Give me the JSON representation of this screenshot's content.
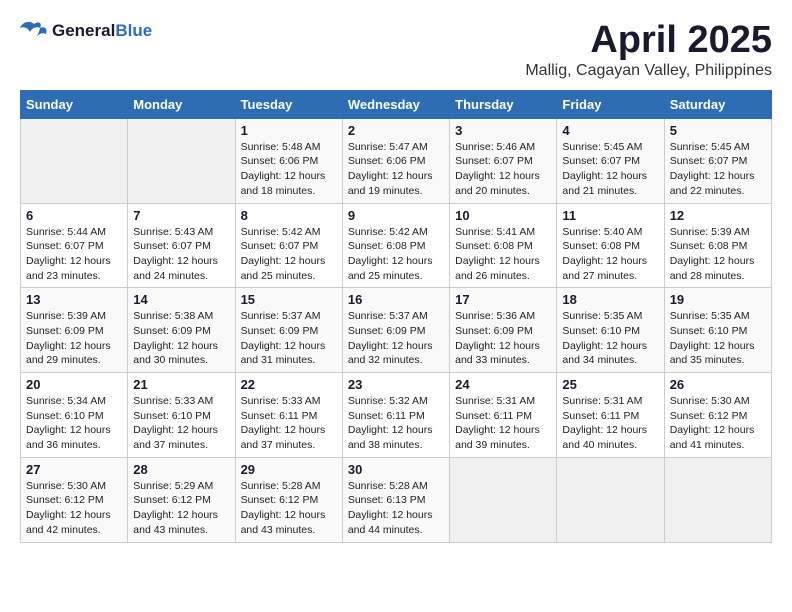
{
  "header": {
    "logo_line1": "General",
    "logo_line2": "Blue",
    "month_title": "April 2025",
    "location": "Mallig, Cagayan Valley, Philippines"
  },
  "weekdays": [
    "Sunday",
    "Monday",
    "Tuesday",
    "Wednesday",
    "Thursday",
    "Friday",
    "Saturday"
  ],
  "weeks": [
    [
      {
        "day": "",
        "empty": true
      },
      {
        "day": "",
        "empty": true
      },
      {
        "day": "1",
        "sunrise": "Sunrise: 5:48 AM",
        "sunset": "Sunset: 6:06 PM",
        "daylight": "Daylight: 12 hours and 18 minutes."
      },
      {
        "day": "2",
        "sunrise": "Sunrise: 5:47 AM",
        "sunset": "Sunset: 6:06 PM",
        "daylight": "Daylight: 12 hours and 19 minutes."
      },
      {
        "day": "3",
        "sunrise": "Sunrise: 5:46 AM",
        "sunset": "Sunset: 6:07 PM",
        "daylight": "Daylight: 12 hours and 20 minutes."
      },
      {
        "day": "4",
        "sunrise": "Sunrise: 5:45 AM",
        "sunset": "Sunset: 6:07 PM",
        "daylight": "Daylight: 12 hours and 21 minutes."
      },
      {
        "day": "5",
        "sunrise": "Sunrise: 5:45 AM",
        "sunset": "Sunset: 6:07 PM",
        "daylight": "Daylight: 12 hours and 22 minutes."
      }
    ],
    [
      {
        "day": "6",
        "sunrise": "Sunrise: 5:44 AM",
        "sunset": "Sunset: 6:07 PM",
        "daylight": "Daylight: 12 hours and 23 minutes."
      },
      {
        "day": "7",
        "sunrise": "Sunrise: 5:43 AM",
        "sunset": "Sunset: 6:07 PM",
        "daylight": "Daylight: 12 hours and 24 minutes."
      },
      {
        "day": "8",
        "sunrise": "Sunrise: 5:42 AM",
        "sunset": "Sunset: 6:07 PM",
        "daylight": "Daylight: 12 hours and 25 minutes."
      },
      {
        "day": "9",
        "sunrise": "Sunrise: 5:42 AM",
        "sunset": "Sunset: 6:08 PM",
        "daylight": "Daylight: 12 hours and 25 minutes."
      },
      {
        "day": "10",
        "sunrise": "Sunrise: 5:41 AM",
        "sunset": "Sunset: 6:08 PM",
        "daylight": "Daylight: 12 hours and 26 minutes."
      },
      {
        "day": "11",
        "sunrise": "Sunrise: 5:40 AM",
        "sunset": "Sunset: 6:08 PM",
        "daylight": "Daylight: 12 hours and 27 minutes."
      },
      {
        "day": "12",
        "sunrise": "Sunrise: 5:39 AM",
        "sunset": "Sunset: 6:08 PM",
        "daylight": "Daylight: 12 hours and 28 minutes."
      }
    ],
    [
      {
        "day": "13",
        "sunrise": "Sunrise: 5:39 AM",
        "sunset": "Sunset: 6:09 PM",
        "daylight": "Daylight: 12 hours and 29 minutes."
      },
      {
        "day": "14",
        "sunrise": "Sunrise: 5:38 AM",
        "sunset": "Sunset: 6:09 PM",
        "daylight": "Daylight: 12 hours and 30 minutes."
      },
      {
        "day": "15",
        "sunrise": "Sunrise: 5:37 AM",
        "sunset": "Sunset: 6:09 PM",
        "daylight": "Daylight: 12 hours and 31 minutes."
      },
      {
        "day": "16",
        "sunrise": "Sunrise: 5:37 AM",
        "sunset": "Sunset: 6:09 PM",
        "daylight": "Daylight: 12 hours and 32 minutes."
      },
      {
        "day": "17",
        "sunrise": "Sunrise: 5:36 AM",
        "sunset": "Sunset: 6:09 PM",
        "daylight": "Daylight: 12 hours and 33 minutes."
      },
      {
        "day": "18",
        "sunrise": "Sunrise: 5:35 AM",
        "sunset": "Sunset: 6:10 PM",
        "daylight": "Daylight: 12 hours and 34 minutes."
      },
      {
        "day": "19",
        "sunrise": "Sunrise: 5:35 AM",
        "sunset": "Sunset: 6:10 PM",
        "daylight": "Daylight: 12 hours and 35 minutes."
      }
    ],
    [
      {
        "day": "20",
        "sunrise": "Sunrise: 5:34 AM",
        "sunset": "Sunset: 6:10 PM",
        "daylight": "Daylight: 12 hours and 36 minutes."
      },
      {
        "day": "21",
        "sunrise": "Sunrise: 5:33 AM",
        "sunset": "Sunset: 6:10 PM",
        "daylight": "Daylight: 12 hours and 37 minutes."
      },
      {
        "day": "22",
        "sunrise": "Sunrise: 5:33 AM",
        "sunset": "Sunset: 6:11 PM",
        "daylight": "Daylight: 12 hours and 37 minutes."
      },
      {
        "day": "23",
        "sunrise": "Sunrise: 5:32 AM",
        "sunset": "Sunset: 6:11 PM",
        "daylight": "Daylight: 12 hours and 38 minutes."
      },
      {
        "day": "24",
        "sunrise": "Sunrise: 5:31 AM",
        "sunset": "Sunset: 6:11 PM",
        "daylight": "Daylight: 12 hours and 39 minutes."
      },
      {
        "day": "25",
        "sunrise": "Sunrise: 5:31 AM",
        "sunset": "Sunset: 6:11 PM",
        "daylight": "Daylight: 12 hours and 40 minutes."
      },
      {
        "day": "26",
        "sunrise": "Sunrise: 5:30 AM",
        "sunset": "Sunset: 6:12 PM",
        "daylight": "Daylight: 12 hours and 41 minutes."
      }
    ],
    [
      {
        "day": "27",
        "sunrise": "Sunrise: 5:30 AM",
        "sunset": "Sunset: 6:12 PM",
        "daylight": "Daylight: 12 hours and 42 minutes."
      },
      {
        "day": "28",
        "sunrise": "Sunrise: 5:29 AM",
        "sunset": "Sunset: 6:12 PM",
        "daylight": "Daylight: 12 hours and 43 minutes."
      },
      {
        "day": "29",
        "sunrise": "Sunrise: 5:28 AM",
        "sunset": "Sunset: 6:12 PM",
        "daylight": "Daylight: 12 hours and 43 minutes."
      },
      {
        "day": "30",
        "sunrise": "Sunrise: 5:28 AM",
        "sunset": "Sunset: 6:13 PM",
        "daylight": "Daylight: 12 hours and 44 minutes."
      },
      {
        "day": "",
        "empty": true
      },
      {
        "day": "",
        "empty": true
      },
      {
        "day": "",
        "empty": true
      }
    ]
  ]
}
